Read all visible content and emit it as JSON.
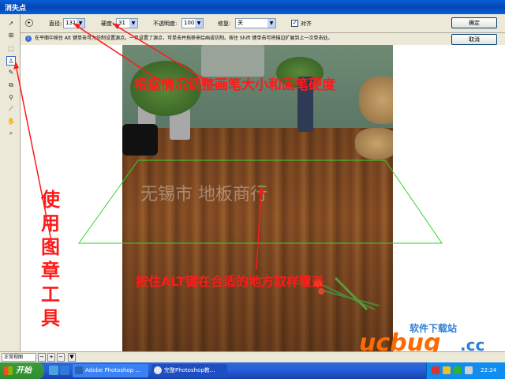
{
  "window": {
    "title": "消失点"
  },
  "options": {
    "diameter_label": "直径:",
    "diameter_value": "131",
    "hardness_label": "硬度:",
    "hardness_value": "31",
    "opacity_label": "不透明度:",
    "opacity_value": "100",
    "heal_label": "修复:",
    "heal_value": "关",
    "align_label": "对齐",
    "align_checked": true,
    "ok_label": "确定",
    "cancel_label": "取消"
  },
  "hint": "在平面中按住 Alt 键单击可为仿制设置源点。一旦设置了源点，可单击并拖移来绘画或仿制。按住 Shift 键单击可将描边扩展到上一次单击处。",
  "annotations": {
    "top": "根据情况调整画笔大小和画笔硬度",
    "middle": "按住ALT键在合适的地方取样覆盖",
    "side": "使用图章工具"
  },
  "watermark": "无锡市          地板商行",
  "status": {
    "zoom": "正常视图"
  },
  "logo": {
    "main": "ucbug",
    "suffix": ".cc",
    "tagline": "软件下载站"
  },
  "taskbar": {
    "start": "开始",
    "tasks": [
      {
        "label": "Adobe Photoshop ..."
      },
      {
        "label": "完整Photoshop教..."
      }
    ],
    "clock": "22:24"
  },
  "colors": {
    "annotation": "#ff1a1a",
    "perspective_grid": "#39d22e",
    "titlebar": "#0a5fd8"
  }
}
